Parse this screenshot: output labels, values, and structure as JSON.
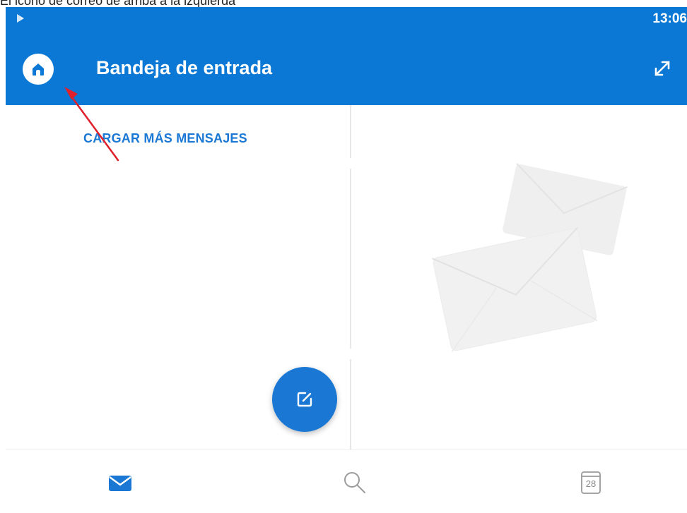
{
  "caption": "El icono de correo de arriba a la izquierda",
  "status_bar": {
    "time": "13:06",
    "left_icon": "play-store-icon"
  },
  "header": {
    "title": "Bandeja de entrada",
    "left_icon": "home-icon",
    "right_icon": "expand-icon"
  },
  "list": {
    "load_more_label": "CARGAR MÁS MENSAJES"
  },
  "reading_pane": {
    "illustration": "envelopes-illustration"
  },
  "compose_button": {
    "icon": "compose-icon"
  },
  "bottom_nav": {
    "items": [
      {
        "name": "mail",
        "icon": "mail-icon",
        "active": true
      },
      {
        "name": "search",
        "icon": "search-icon",
        "active": false
      },
      {
        "name": "calendar",
        "icon": "calendar-icon",
        "day": "28",
        "active": false
      }
    ]
  },
  "colors": {
    "brand_blue": "#0a78d4",
    "accent_blue": "#1a78d4",
    "annotation_arrow": "#e0202a"
  }
}
